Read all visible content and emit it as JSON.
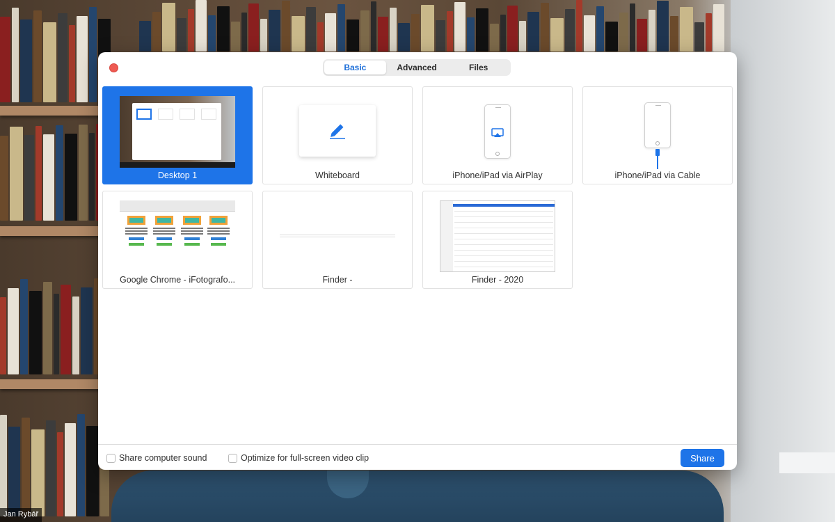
{
  "dialog": {
    "tabs": [
      {
        "label": "Basic",
        "active": true
      },
      {
        "label": "Advanced",
        "active": false
      },
      {
        "label": "Files",
        "active": false
      }
    ],
    "share_sources": [
      {
        "label": "Desktop 1",
        "selected": true,
        "kind": "desktop"
      },
      {
        "label": "Whiteboard",
        "selected": false,
        "kind": "whiteboard",
        "icon": "pencil-icon"
      },
      {
        "label": "iPhone/iPad via AirPlay",
        "selected": false,
        "kind": "airplay",
        "icon": "airplay-icon"
      },
      {
        "label": "iPhone/iPad via Cable",
        "selected": false,
        "kind": "cable",
        "icon": "cable-icon"
      },
      {
        "label": "Google Chrome - iFotografo...",
        "selected": false,
        "kind": "window"
      },
      {
        "label": "Finder -",
        "selected": false,
        "kind": "window"
      },
      {
        "label": "Finder - 2020",
        "selected": false,
        "kind": "window"
      }
    ],
    "footer": {
      "share_sound_label": "Share computer sound",
      "share_sound_checked": false,
      "optimize_label": "Optimize for full-screen video clip",
      "optimize_checked": false,
      "share_button": "Share"
    }
  },
  "participant": {
    "name": "Jan Rybář"
  },
  "colors": {
    "accent": "#1e74e8",
    "close": "#ee5a52"
  }
}
